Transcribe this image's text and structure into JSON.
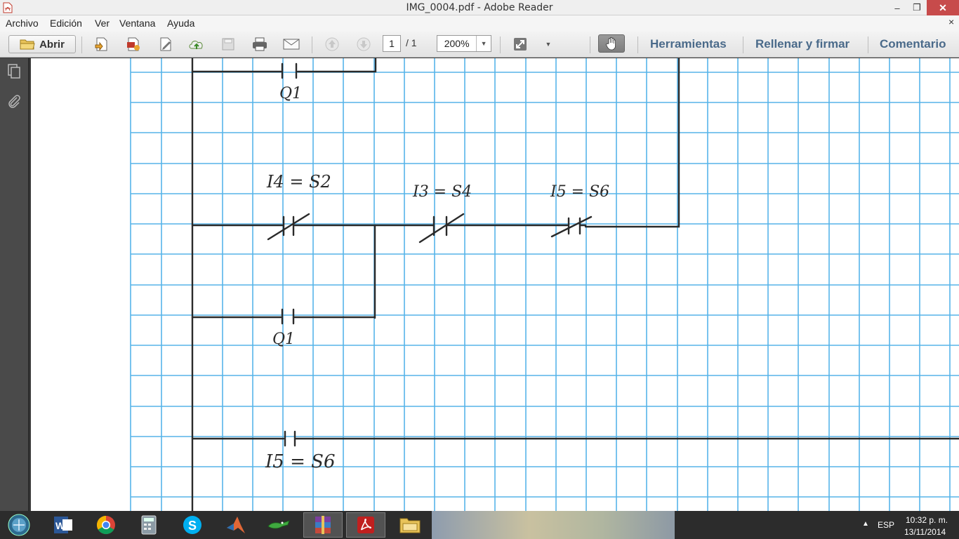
{
  "window": {
    "title": "IMG_0004.pdf - Adobe Reader",
    "min": "–",
    "max": "❐",
    "close": "✕"
  },
  "menu": {
    "items": [
      "Archivo",
      "Edición",
      "Ver",
      "Ventana",
      "Ayuda"
    ],
    "close_doc": "×"
  },
  "toolbar": {
    "open_label": "Abrir",
    "page_current": "1",
    "page_total": "/ 1",
    "zoom": "200%",
    "tools_tab": "Herramientas",
    "fill_sign_tab": "Rellenar y firmar",
    "comment_tab": "Comentario"
  },
  "document": {
    "labels": {
      "q1_top": "Q1",
      "i4": "I4 = S2",
      "i3": "I3 = S4",
      "i5_mid": "I5 = S6",
      "q1_bottom": "Q1",
      "i5_bottom": "I5 = S6"
    }
  },
  "tray": {
    "lang": "ESP",
    "time": "10:32 p. m.",
    "date": "13/11/2014"
  },
  "colors": {
    "grid": "#39a7e6",
    "ink": "#2a2a2a",
    "accent_tab": "#4a6a8a"
  }
}
